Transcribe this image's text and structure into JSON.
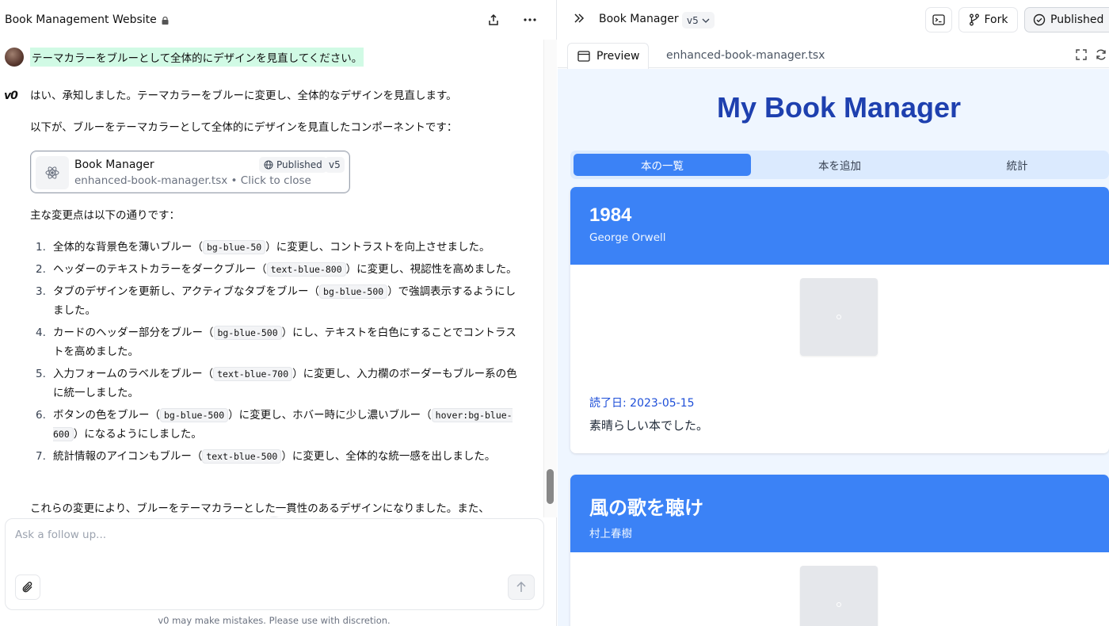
{
  "left": {
    "title": "Book Management Website",
    "user_message": "テーマカラーをブルーとして全体的にデザインを見直してください。",
    "v0_logo": "v0",
    "reply_intro": "はい、承知しました。テーマカラーをブルーに変更し、全体的なデザインを見直します。",
    "reply_line2": "以下が、ブルーをテーマカラーとして全体的にデザインを見直したコンポーネントです：",
    "card": {
      "title": "Book Manager",
      "subtitle": "enhanced-book-manager.tsx • Click to close",
      "published": "Published",
      "version": "v5"
    },
    "changes_heading": "主な変更点は以下の通りです：",
    "changes": [
      {
        "num": "1.",
        "a": "全体的な背景色を薄いブルー（",
        "code": "bg-blue-50",
        "b": "）に変更し、コントラストを向上させました。"
      },
      {
        "num": "2.",
        "a": "ヘッダーのテキストカラーをダークブルー（",
        "code": "text-blue-800",
        "b": "）に変更し、視認性を高めました。"
      },
      {
        "num": "3.",
        "a": "タブのデザインを更新し、アクティブなタブをブルー（",
        "code": "bg-blue-500",
        "b": "）で強調表示するようにしました。"
      },
      {
        "num": "4.",
        "a": "カードのヘッダー部分をブルー（",
        "code": "bg-blue-500",
        "b": "）にし、テキストを白色にすることでコントラストを高めました。"
      },
      {
        "num": "5.",
        "a": "入力フォームのラベルをブルー（",
        "code": "text-blue-700",
        "b": "）に変更し、入力欄のボーダーもブルー系の色に統一しました。"
      },
      {
        "num": "6.",
        "a": "ボタンの色をブルー（",
        "code": "bg-blue-500",
        "b": "）に変更し、ホバー時に少し濃いブルー（",
        "code2": "hover:bg-blue-600",
        "c": "）になるようにしました。"
      },
      {
        "num": "7.",
        "a": "統計情報のアイコンもブルー（",
        "code": "text-blue-500",
        "b": "）に変更し、全体的な統一感を出しました。"
      }
    ],
    "closing": "これらの変更により、ブルーをテーマカラーとした一貫性のあるデザインになりました。また、",
    "input_placeholder": "Ask a follow up...",
    "disclaimer": "v0 may make mistakes. Please use with discretion."
  },
  "right": {
    "title": "Book Manager",
    "version": "v5",
    "fork_label": "Fork",
    "published_label": "Published",
    "tab_preview": "Preview",
    "tab_file": "enhanced-book-manager.tsx"
  },
  "app": {
    "title": "My Book Manager",
    "tabs": [
      "本の一覧",
      "本を追加",
      "統計"
    ],
    "active_tab": 0,
    "books": [
      {
        "title": "1984",
        "author": "George Orwell",
        "read_date": "読了日: 2023-05-15",
        "note": "素晴らしい本でした。"
      },
      {
        "title": "風の歌を聴け",
        "author": "村上春樹"
      }
    ]
  },
  "colors": {
    "accent": "#3b82f6",
    "title_blue": "#1e40af",
    "preview_bg": "#eff6ff",
    "tabs_bg": "#dbeafe",
    "user_bubble": "#d1fae5"
  }
}
